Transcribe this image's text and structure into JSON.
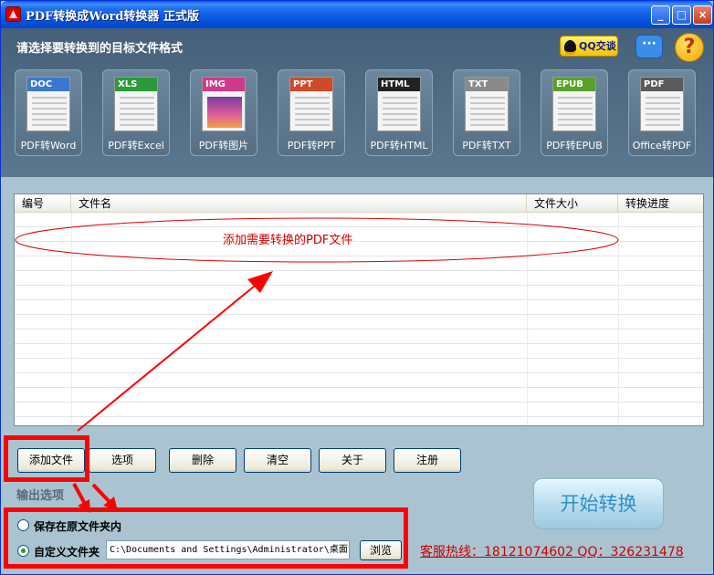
{
  "window": {
    "title": "PDF转换成Word转换器 正式版",
    "minimize": "_",
    "maximize": "□",
    "close": "×"
  },
  "header": {
    "prompt": "请选择要转换到的目标文件格式",
    "qq_button": "QQ交谈",
    "help": "?",
    "chat": "···"
  },
  "formats": [
    {
      "tag": "DOC",
      "label": "PDF转Word",
      "color": "#3a78d0"
    },
    {
      "tag": "XLS",
      "label": "PDF转Excel",
      "color": "#2a9a3a"
    },
    {
      "tag": "IMG",
      "label": "PDF转图片",
      "color": "#d03a8a"
    },
    {
      "tag": "PPT",
      "label": "PDF转PPT",
      "color": "#d04a2a"
    },
    {
      "tag": "HTML",
      "label": "PDF转HTML",
      "color": "#222222"
    },
    {
      "tag": "TXT",
      "label": "PDF转TXT",
      "color": "#8a8a8a"
    },
    {
      "tag": "EPUB",
      "label": "PDF转EPUB",
      "color": "#5aa02a"
    },
    {
      "tag": "PDF",
      "label": "Office转PDF",
      "color": "#5a5a5a"
    }
  ],
  "file_list": {
    "columns": [
      "编号",
      "文件名",
      "文件大小",
      "转换进度"
    ],
    "hint": "添加需要转换的PDF文件"
  },
  "actions": {
    "add": "添加文件",
    "options": "选项",
    "delete": "删除",
    "clear": "清空",
    "about": "关于",
    "register": "注册"
  },
  "output": {
    "title": "输出选项",
    "save_original": "保存在原文件夹内",
    "custom_folder": "自定义文件夹",
    "path": "C:\\Documents and Settings\\Administrator\\桌面",
    "browse": "浏览",
    "selected": "custom_folder"
  },
  "start_button": "开始转换",
  "hotline": "客服热线：18121074602 QQ：326231478",
  "colors": {
    "annotation_red": "#ff0000",
    "hint_red": "#cc0000"
  }
}
